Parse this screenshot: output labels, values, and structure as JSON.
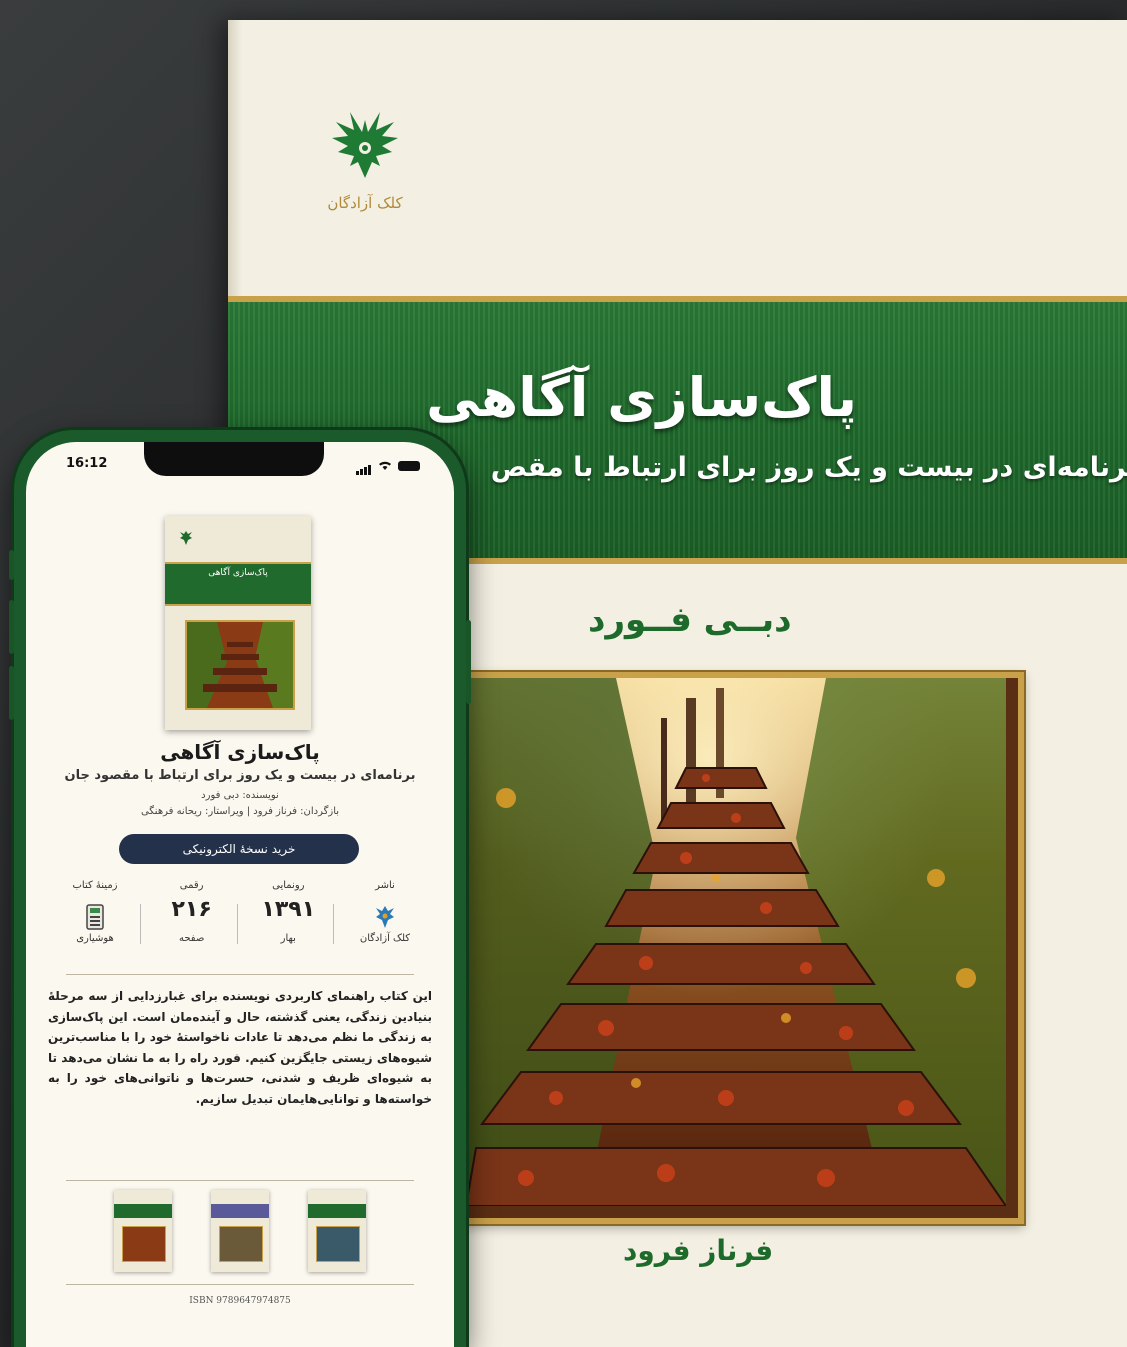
{
  "cover": {
    "publisher_logo_text": "کلک آزادگان",
    "title": "پاک‌سازی آگاهی",
    "subtitle": "برنامه‌ای در بیست و یک روز برای ارتباط با مقص",
    "author": "دبــی فــورد",
    "translator": "فرناز فرود"
  },
  "phone": {
    "status": {
      "time": "16:12"
    },
    "book": {
      "cover_title": "پاک‌سازی آگاهی",
      "title": "پاک‌سازی آگاهی",
      "subtitle": "برنامه‌ای در بیست و یک روز برای ارتباط با مقصود جان",
      "author_line": "نویسنده: دبی فورد",
      "translator_line": "بازگردان: فرناز فرود | ویراستار: ریحانه فرهنگی"
    },
    "buy_button": "خرید نسخهٔ الکترونیکی",
    "stats": [
      {
        "label": "ناشر",
        "value": "",
        "bottom": "کلک آزادگان",
        "icon": "publisher-logo-icon"
      },
      {
        "label": "رونمایی",
        "value": "۱۳۹۱",
        "bottom": "بهار",
        "icon": ""
      },
      {
        "label": "رقمی",
        "value": "۲۱۶",
        "bottom": "صفحه",
        "icon": ""
      },
      {
        "label": "زمینهٔ کتاب",
        "value": "",
        "bottom": "هوشیاری",
        "icon": "calculator-icon"
      }
    ],
    "description": "این کتاب راهنمای کاربردی نویسنده برای غبارزدایی از سه مرحلهٔ بنیادین زندگی، یعنی گذشته، حال و آینده‌مان است. این پاک‌سازی به زندگی ما نظم می‌دهد تا عادات ناخواستهٔ خود را با مناسب‌ترین شیوه‌های زیستی جایگزین کنیم. فورد راه را به ما نشان می‌دهد تا به شیوه‌ای ظریف و شدنی، حسرت‌ها و ناتوانی‌های خود را به خواسته‌ها و توانایی‌هایمان تبدیل سازیم.",
    "isbn": "ISBN 9789647974875",
    "related_colors": [
      "#1f6a2c",
      "#5a5a9a",
      "#1f6a2c"
    ]
  },
  "colors": {
    "green": "#1f6a2c",
    "gold": "#c9a14a",
    "navy": "#23314a"
  }
}
